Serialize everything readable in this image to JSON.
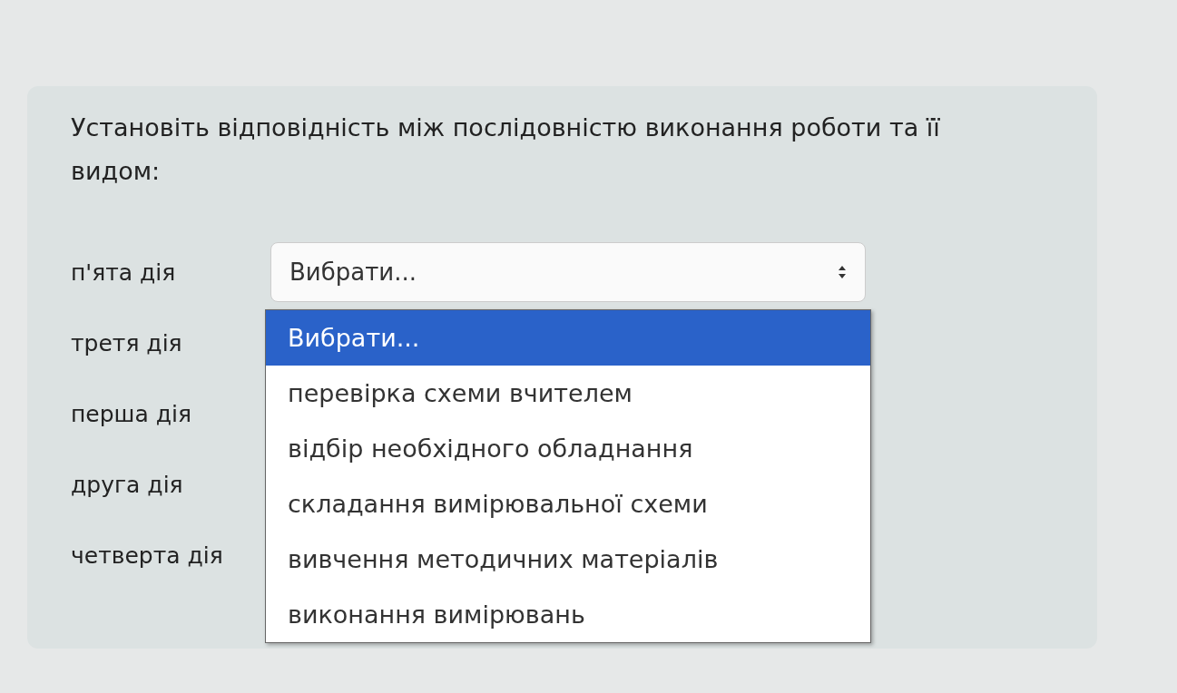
{
  "question": "Установіть відповідність між послідовністю виконання роботи та її видом:",
  "rows": [
    {
      "label": "п'ята дія"
    },
    {
      "label": "третя дія"
    },
    {
      "label": "перша дія"
    },
    {
      "label": "друга дія"
    },
    {
      "label": "четверта дія"
    }
  ],
  "select": {
    "value": "Вибрати..."
  },
  "options": [
    {
      "label": "Вибрати...",
      "selected": true
    },
    {
      "label": "перевірка схеми вчителем",
      "selected": false
    },
    {
      "label": "відбір необхідного обладнання",
      "selected": false
    },
    {
      "label": "складання вимірювальної схеми",
      "selected": false
    },
    {
      "label": "вивчення методичних матеріалів",
      "selected": false
    },
    {
      "label": "виконання вимірювань",
      "selected": false
    }
  ]
}
